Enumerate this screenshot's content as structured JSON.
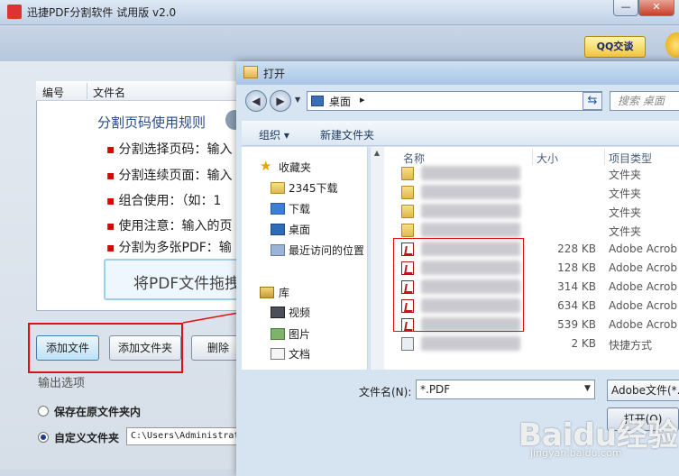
{
  "app": {
    "title": "迅捷PDF分割软件 试用版 v2.0",
    "min_label": "—",
    "close_label": "✕",
    "qq_label": "QQ交谈",
    "list_headers": [
      "编号",
      "文件名"
    ],
    "rules_title": "分割页码使用规则",
    "rules": [
      "分割选择页码：输入",
      "分割连续页面：输入",
      "组合使用：（如：1",
      "使用注意：输入的页",
      "分割为多张PDF：输"
    ],
    "drop_text": "将PDF文件拖拽",
    "buttons": {
      "add_file": "添加文件",
      "add_folder": "添加文件夹",
      "delete": "删除"
    },
    "output_title": "输出选项",
    "option_same_folder": "保存在原文件夹内",
    "option_custom_folder": "自定义文件夹",
    "custom_path": "C:\\Users\\Administrat"
  },
  "dialog": {
    "title": "打开",
    "address": "桌面",
    "address_arrow": "▸",
    "search_placeholder": "搜索 桌面",
    "organize": "组织 ▾",
    "new_folder": "新建文件夹",
    "nav": {
      "favorites": "收藏夹",
      "items": [
        "2345下载",
        "下载",
        "桌面",
        "最近访问的位置"
      ],
      "library": "库",
      "lib_items": [
        "视频",
        "图片",
        "文档"
      ]
    },
    "columns": {
      "name": "名称",
      "size": "大小",
      "type": "项目类型"
    },
    "files": [
      {
        "kind": "folder",
        "size": "",
        "type": "文件夹"
      },
      {
        "kind": "folder",
        "size": "",
        "type": "文件夹"
      },
      {
        "kind": "folder",
        "size": "",
        "type": "文件夹"
      },
      {
        "kind": "folder",
        "size": "",
        "type": "文件夹"
      },
      {
        "kind": "pdf",
        "size": "228 KB",
        "type": "Adobe Acrob"
      },
      {
        "kind": "pdf",
        "size": "128 KB",
        "type": "Adobe Acrob"
      },
      {
        "kind": "pdf",
        "size": "314 KB",
        "type": "Adobe Acrob"
      },
      {
        "kind": "pdf",
        "size": "634 KB",
        "type": "Adobe Acrob"
      },
      {
        "kind": "pdf",
        "size": "539 KB",
        "type": "Adobe Acrob"
      },
      {
        "kind": "shortcut",
        "size": "2 KB",
        "type": "快捷方式"
      }
    ],
    "filename_label": "文件名(N):",
    "filename_value": "*.PDF",
    "filetype_value": "Adobe文件(*.",
    "open_label": "打开(O)"
  },
  "watermark": {
    "main": "Baidu经验",
    "sub": "jingyan.baidu.com"
  },
  "colors": {
    "highlight": "#d11",
    "accent": "#2a4c8a"
  }
}
